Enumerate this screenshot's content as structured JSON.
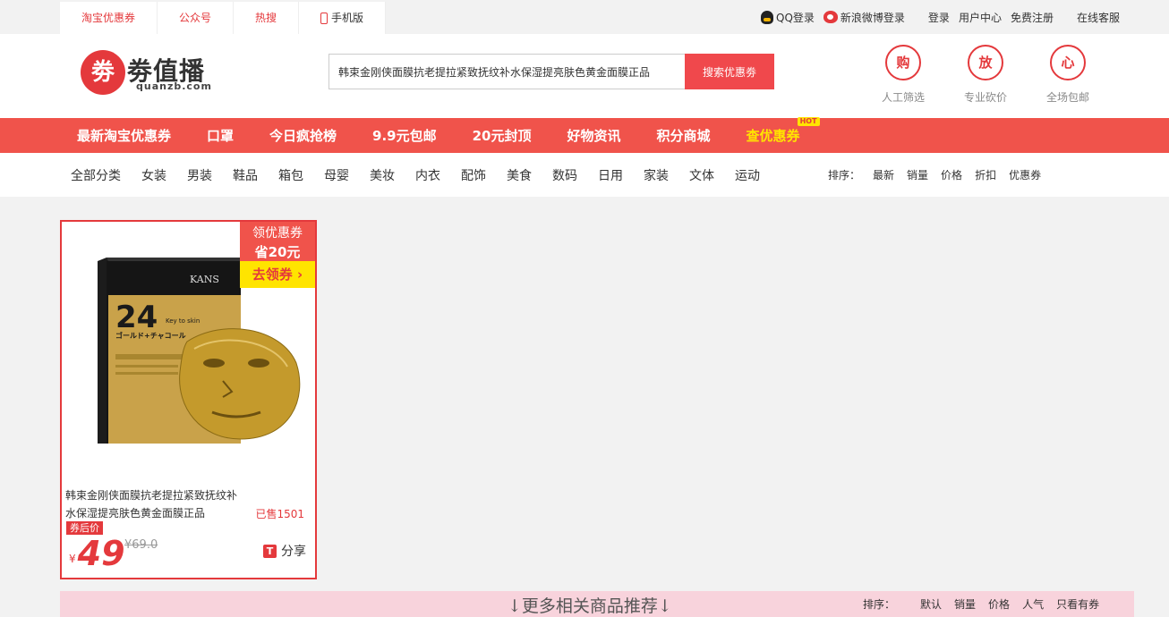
{
  "topbar": {
    "tabs": [
      "淘宝优惠券",
      "公众号",
      "热搜",
      "手机版"
    ],
    "qq_login": "QQ登录",
    "weibo_login": "新浪微博登录",
    "login": "登录",
    "user_center": "用户中心",
    "register": "免费注册",
    "service": "在线客服"
  },
  "logo": {
    "badge": "劵",
    "title": "劵值播",
    "sub": "quanzb.com"
  },
  "search": {
    "value": "韩束金刚侠面膜抗老提拉紧致抚纹补水保湿提亮肤色黄金面膜正品",
    "button": "搜索优惠劵"
  },
  "features": [
    {
      "badge": "购",
      "label": "人工筛选"
    },
    {
      "badge": "放",
      "label": "专业砍价"
    },
    {
      "badge": "心",
      "label": "全场包邮"
    }
  ],
  "nav": {
    "items": [
      "最新淘宝优惠券",
      "口罩",
      "今日疯抢榜",
      "9.9元包邮",
      "20元封顶",
      "好物资讯",
      "积分商城"
    ],
    "highlight": "查优惠券",
    "hot": "HOT"
  },
  "categories": [
    "全部分类",
    "女装",
    "男装",
    "鞋品",
    "箱包",
    "母婴",
    "美妆",
    "内衣",
    "配饰",
    "美食",
    "数码",
    "日用",
    "家装",
    "文体",
    "运动"
  ],
  "sort": {
    "label": "排序：",
    "options": [
      "最新",
      "销量",
      "价格",
      "折扣",
      "优惠券"
    ]
  },
  "product": {
    "coupon_label": "领优惠券",
    "coupon_amount": "省20元",
    "coupon_go": "去领券",
    "box_brand": "KANS",
    "box_number": "24",
    "box_tag": "Key to skin",
    "box_jp": "ゴールド+チャコール",
    "title": "韩束金刚侠面膜抗老提拉紧致抚纹补水保湿提亮肤色黄金面膜正品",
    "sold": "已售1501",
    "price_tag": "券后价",
    "currency": "¥",
    "price": "49",
    "original": "¥69.0",
    "share_icon": "T",
    "share": "分享"
  },
  "more": {
    "title": "↓更多相关商品推荐↓",
    "sort_label": "排序：",
    "options": [
      "默认",
      "销量",
      "价格",
      "人气",
      "只看有券"
    ]
  },
  "colors": {
    "brand_red": "#e4393c",
    "nav_red": "#f0534b",
    "highlight_yellow": "#ffe400",
    "more_bar_pink": "#f8d3dc"
  }
}
